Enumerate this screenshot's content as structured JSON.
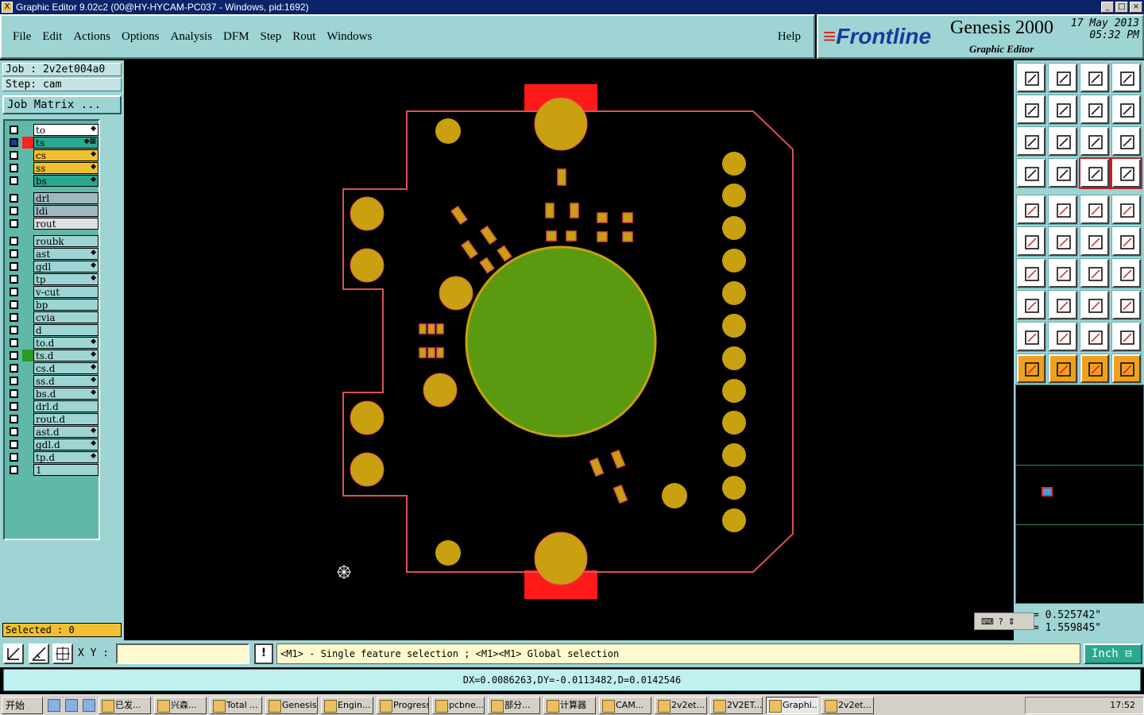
{
  "window": {
    "title": "Graphic Editor 9.02c2 (00@HY-HYCAM-PC037 - Windows, pid:1692)"
  },
  "menu": [
    "File",
    "Edit",
    "Actions",
    "Options",
    "Analysis",
    "DFM",
    "Step",
    "Rout",
    "Windows"
  ],
  "help_label": "Help",
  "brand": {
    "logo": "Frontline",
    "product": "Genesis 2000",
    "subtitle": "Graphic Editor",
    "date": "17 May 2013",
    "time": "05:32 PM"
  },
  "job": {
    "job": "Job : 2v2et004a0",
    "step": "Step: cam",
    "matrix": "Job Matrix ..."
  },
  "layers": [
    {
      "name": "to",
      "bg": "#ffffff",
      "color": "",
      "mark": "◆",
      "active": false
    },
    {
      "name": "ts",
      "bg": "#2aa890",
      "color": "#ff2020",
      "mark": "◆▦",
      "active": true
    },
    {
      "name": "cs",
      "bg": "#f0c030",
      "color": "",
      "mark": "◆",
      "active": false
    },
    {
      "name": "ss",
      "bg": "#f0c030",
      "color": "",
      "mark": "◆",
      "active": false
    },
    {
      "name": "bs",
      "bg": "#2aa890",
      "color": "",
      "mark": "◆",
      "active": false
    },
    {
      "name": "drl",
      "bg": "#a0b8c0",
      "color": "",
      "mark": "",
      "active": false
    },
    {
      "name": "ldi",
      "bg": "#a0b8c0",
      "color": "",
      "mark": "",
      "active": false
    },
    {
      "name": "rout",
      "bg": "#e0e0e0",
      "color": "",
      "mark": "",
      "active": false
    },
    {
      "name": "roubk",
      "bg": "#9ed4d4",
      "color": "",
      "mark": "",
      "active": false
    },
    {
      "name": "ast",
      "bg": "#9ed4d4",
      "color": "",
      "mark": "◆",
      "active": false
    },
    {
      "name": "gdl",
      "bg": "#9ed4d4",
      "color": "",
      "mark": "◆",
      "active": false
    },
    {
      "name": "tp",
      "bg": "#9ed4d4",
      "color": "",
      "mark": "◆",
      "active": false
    },
    {
      "name": "v-cut",
      "bg": "#9ed4d4",
      "color": "",
      "mark": "",
      "active": false
    },
    {
      "name": "bp",
      "bg": "#9ed4d4",
      "color": "",
      "mark": "",
      "active": false
    },
    {
      "name": "cvia",
      "bg": "#9ed4d4",
      "color": "",
      "mark": "",
      "active": false
    },
    {
      "name": "d",
      "bg": "#9ed4d4",
      "color": "",
      "mark": "",
      "active": false
    },
    {
      "name": "to.d",
      "bg": "#9ed4d4",
      "color": "",
      "mark": "◆",
      "active": false
    },
    {
      "name": "ts.d",
      "bg": "#9ed4d4",
      "color": "#2a9a20",
      "mark": "◆",
      "active": false
    },
    {
      "name": "cs.d",
      "bg": "#9ed4d4",
      "color": "",
      "mark": "◆",
      "active": false
    },
    {
      "name": "ss.d",
      "bg": "#9ed4d4",
      "color": "",
      "mark": "◆",
      "active": false
    },
    {
      "name": "bs.d",
      "bg": "#9ed4d4",
      "color": "",
      "mark": "◆",
      "active": false
    },
    {
      "name": "drl.d",
      "bg": "#9ed4d4",
      "color": "",
      "mark": "",
      "active": false
    },
    {
      "name": "rout.d",
      "bg": "#9ed4d4",
      "color": "",
      "mark": "",
      "active": false
    },
    {
      "name": "ast.d",
      "bg": "#9ed4d4",
      "color": "",
      "mark": "◆",
      "active": false
    },
    {
      "name": "gdl.d",
      "bg": "#9ed4d4",
      "color": "",
      "mark": "◆",
      "active": false
    },
    {
      "name": "tp.d",
      "bg": "#9ed4d4",
      "color": "",
      "mark": "◆",
      "active": false
    },
    {
      "name": "1",
      "bg": "#9ed4d4",
      "color": "",
      "mark": "",
      "active": false
    }
  ],
  "selected": "Selected : 0",
  "coords": {
    "x": "= 0.525742\"",
    "y": "= 1.559845\""
  },
  "xy_label": "X Y :",
  "xy_value": "",
  "hint": "<M1> - Single feature selection ; <M1><M1> Global selection",
  "unit": "Inch",
  "measure": "DX=0.0086263,DY=-0.0113482,D=0.0142546",
  "taskbar": {
    "start": "开始",
    "tasks": [
      "已发...",
      "兴森...",
      "Total ...",
      "Genesis",
      "Engin...",
      "Progress",
      "pcbne...",
      "部分...",
      "计算器",
      "CAM...",
      "2v2et...",
      "2V2ET...",
      "Graphi...",
      "2v2et..."
    ],
    "active_index": 12,
    "clock": "17:52"
  },
  "colors": {
    "pad": "#c8a010",
    "outline": "#e05050",
    "copper_green": "#5a9a10",
    "mask_red": "#ff1a1a",
    "panel": "#9ed4d4"
  }
}
